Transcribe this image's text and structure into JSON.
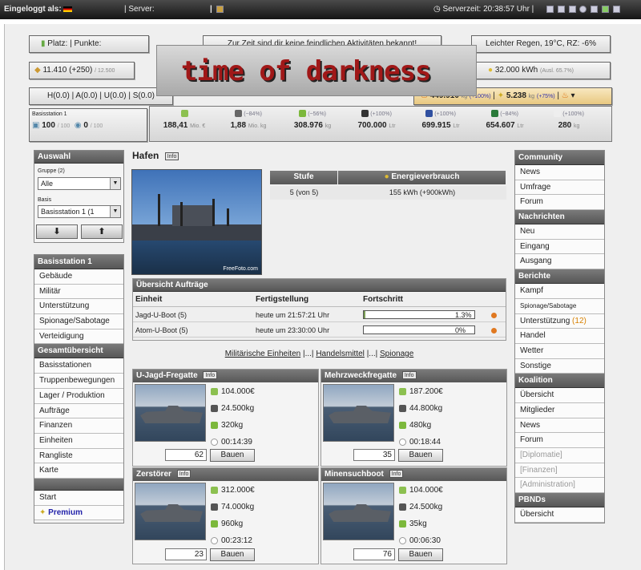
{
  "topbar": {
    "logged_in_label": "Eingeloggt als:",
    "server_label": "| Server:",
    "sep": "|",
    "servertime": "Serverzeit: 20:38:57 Uhr |"
  },
  "header": {
    "platz": "Platz:",
    "punkte": "| Punkte:",
    "message": "Zur Zeit sind dir keine feindlichen Aktivitäten bekannt!",
    "weather": "Leichter Regen, 19°C, RZ: -6%",
    "money": "11.410 (+250)",
    "money_max": "/ 12.500",
    "energy": "32.000 kWh",
    "energy_sub": "(Ausl. 65.7%)",
    "hauf": "H(0.0) | A(0.0) | U(0.0) | S(0.0)",
    "r1": "449.910",
    "r1_unit": "kg",
    "r1_pct": "(+100%)",
    "r2": "5.238",
    "r2_unit": "kg",
    "r2_pct": "(+75%)",
    "logo": "time of darkness"
  },
  "base": {
    "name": "Basisstation 1",
    "v1": "100",
    "v1_max": "/ 100",
    "v2": "0",
    "v2_max": "/ 100"
  },
  "resources": [
    {
      "pct": "",
      "value": "188,41",
      "unit": "Mio. €",
      "color": "#8cc050"
    },
    {
      "pct": "(~84%)",
      "value": "1,88",
      "unit": "Mio. kg",
      "color": "#666"
    },
    {
      "pct": "(~56%)",
      "value": "308.976",
      "unit": "kg",
      "color": "#7cb83c"
    },
    {
      "pct": "(+100%)",
      "value": "700.000",
      "unit": "Ltr",
      "color": "#333"
    },
    {
      "pct": "(+100%)",
      "value": "699.915",
      "unit": "Ltr",
      "color": "#3050a0"
    },
    {
      "pct": "(~84%)",
      "value": "654.607",
      "unit": "Ltr",
      "color": "#2a7a3a"
    },
    {
      "pct": "(+100%)",
      "value": "280",
      "unit": "kg",
      "color": "#eee"
    }
  ],
  "left": {
    "auswahl": "Auswahl",
    "gruppe_label": "Gruppe (2)",
    "gruppe_value": "Alle",
    "basis_label": "Basis",
    "basis_value": "Basisstation 1 (1",
    "down": "⬇",
    "up": "⬆",
    "section1": "Basisstation 1",
    "items1": [
      "Gebäude",
      "Militär",
      "Unterstützung",
      "Spionage/Sabotage",
      "Verteidigung"
    ],
    "section2": "Gesamtübersicht",
    "items2": [
      "Basisstationen",
      "Truppenbewegungen",
      "Lager / Produktion",
      "Aufträge",
      "Finanzen",
      "Einheiten",
      "Rangliste",
      "Karte"
    ],
    "start": "Start",
    "premium": "Premium"
  },
  "main": {
    "title": "Hafen",
    "info": "Info",
    "photo_credit": "FreeFoto.com",
    "stufe_h": "Stufe",
    "energie_h": "Energieverbrauch",
    "stufe": "5 (von 5)",
    "energie": "155 kWh (+900kWh)",
    "orders_title": "Übersicht Aufträge",
    "col_einheit": "Einheit",
    "col_fertig": "Fertigstellung",
    "col_fort": "Fortschritt",
    "orders": [
      {
        "unit": "Jagd-U-Boot (5)",
        "done": "heute um 21:57:21 Uhr",
        "progress": 1.3,
        "pct": "1.3%"
      },
      {
        "unit": "Atom-U-Boot (5)",
        "done": "heute um 23:30:00 Uhr",
        "progress": 0,
        "pct": "0%"
      }
    ],
    "links": {
      "mil": "Militärische Einheiten",
      "sep1": "|...|",
      "handel": "Handelsmittel",
      "sep2": "|...|",
      "spio": "Spionage"
    },
    "units": [
      {
        "name": "U-Jagd-Fregatte",
        "c1": "104.000€",
        "c2": "24.500kg",
        "c3": "320kg",
        "t": "00:14:39",
        "qty": "62",
        "btn": "Bauen"
      },
      {
        "name": "Mehrzweckfregatte",
        "c1": "187.200€",
        "c2": "44.800kg",
        "c3": "480kg",
        "t": "00:18:44",
        "qty": "35",
        "btn": "Bauen"
      },
      {
        "name": "Zerstörer",
        "c1": "312.000€",
        "c2": "74.000kg",
        "c3": "960kg",
        "t": "00:23:12",
        "qty": "23",
        "btn": "Bauen"
      },
      {
        "name": "Minensuchboot",
        "c1": "104.000€",
        "c2": "24.500kg",
        "c3": "35kg",
        "t": "00:06:30",
        "qty": "76",
        "btn": "Bauen"
      }
    ]
  },
  "right": {
    "community": "Community",
    "community_items": [
      "News",
      "Umfrage",
      "Forum"
    ],
    "nachrichten": "Nachrichten",
    "nachrichten_items": [
      "Neu",
      "Eingang",
      "Ausgang"
    ],
    "berichte": "Berichte",
    "berichte_items": [
      "Kampf",
      "Spionage/Sabotage",
      "Unterstützung",
      "Handel",
      "Wetter",
      "Sonstige"
    ],
    "unterst_count": "(12)",
    "koalition": "Koalition",
    "koalition_items": [
      "Übersicht",
      "Mitglieder",
      "News",
      "Forum"
    ],
    "koalition_disabled": [
      "[Diplomatie]",
      "[Finanzen]",
      "[Administration]"
    ],
    "pbnd": "PBNDs",
    "pbnd_items": [
      "Übersicht"
    ]
  }
}
